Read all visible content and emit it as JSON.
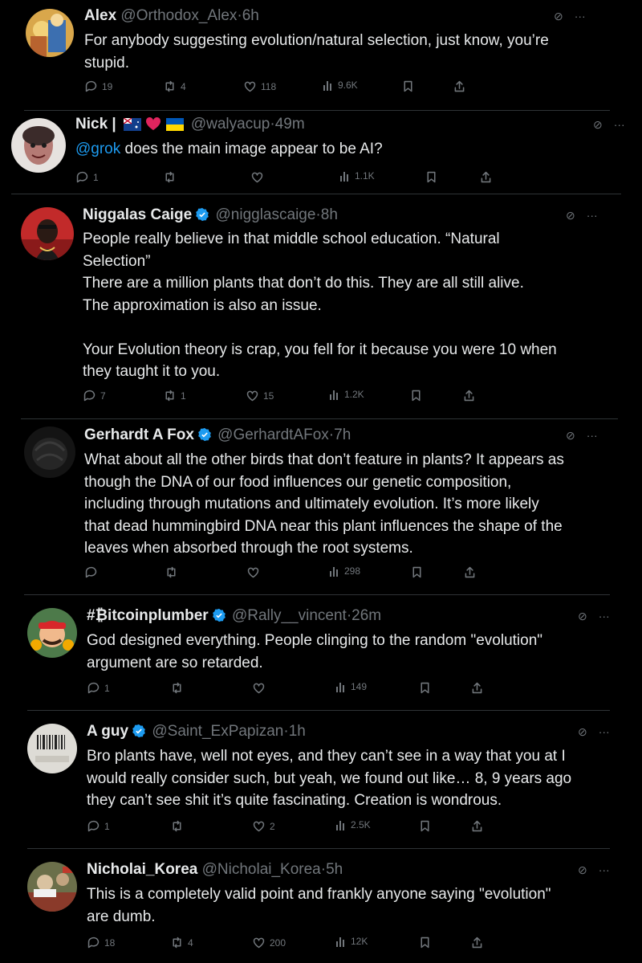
{
  "tweets": [
    {
      "name": "Alex",
      "handle": "@Orthodox_Alex",
      "time": "6h",
      "lines": [
        "For anybody suggesting evolution/natural selection, just know, you’re",
        "stupid."
      ],
      "replies": "19",
      "reposts": "4",
      "likes": "118",
      "views": "9.6K",
      "verified": false
    },
    {
      "name": "Nick |",
      "handle": "@walyacup",
      "time": "49m",
      "mention": "@grok",
      "lines": [
        " does the main image appear to be AI?"
      ],
      "replies": "1",
      "reposts": "",
      "likes": "",
      "views": "1.1K",
      "verified": false,
      "flags": [
        "australia-flag",
        "heart",
        "ukraine-flag"
      ]
    },
    {
      "name": "Niggalas Caige",
      "handle": "@nigglascaige",
      "time": "8h",
      "lines": [
        "People really believe in that middle school education. “Natural",
        "Selection”",
        "There are a million plants that don’t do this. They are all still alive.",
        "The approximation is also an issue.",
        "",
        "Your Evolution theory is crap, you fell for it because you were 10 when",
        "they taught it to you."
      ],
      "replies": "7",
      "reposts": "1",
      "likes": "15",
      "views": "1.2K",
      "verified": true
    },
    {
      "name": "Gerhardt A Fox",
      "handle": "@GerhardtAFox",
      "time": "7h",
      "lines": [
        "What about all the other birds that don’t feature in plants? It appears as",
        "though the DNA of our food influences our genetic composition,",
        "including through mutations and ultimately evolution. It’s more likely",
        "that dead hummingbird DNA near this plant influences the shape of the",
        "leaves when absorbed through the root systems."
      ],
      "replies": "",
      "reposts": "",
      "likes": "",
      "views": "298",
      "verified": true
    },
    {
      "name": "#₿itcoinplumber",
      "handle": "@Rally__vincent",
      "time": "26m",
      "lines": [
        "God designed everything.  People clinging to the random \"evolution\"",
        "argument are so retarded."
      ],
      "replies": "1",
      "reposts": "",
      "likes": "",
      "views": "149",
      "verified": true
    },
    {
      "name": "A guy",
      "handle": "@Saint_ExPapizan",
      "time": "1h",
      "lines": [
        "Bro plants have, well not eyes, and they can’t see in a way that you at I",
        "would really consider such, but yeah, we found out like… 8, 9 years ago",
        "they can’t see shit it’s quite fascinating. Creation is wondrous."
      ],
      "replies": "1",
      "reposts": "",
      "likes": "2",
      "views": "2.5K",
      "verified": true
    },
    {
      "name": "Nicholai_Korea",
      "handle": "@Nicholai_Korea",
      "time": "5h",
      "lines": [
        "This is a completely valid point and frankly anyone saying \"evolution\"",
        "are dumb."
      ],
      "replies": "18",
      "reposts": "4",
      "likes": "200",
      "views": "12K",
      "verified": false
    }
  ],
  "colors": {
    "background": "#000000",
    "text": "#e7e9ea",
    "muted": "#71767b",
    "accent": "#1d9bf0",
    "divider": "#2f3336"
  }
}
